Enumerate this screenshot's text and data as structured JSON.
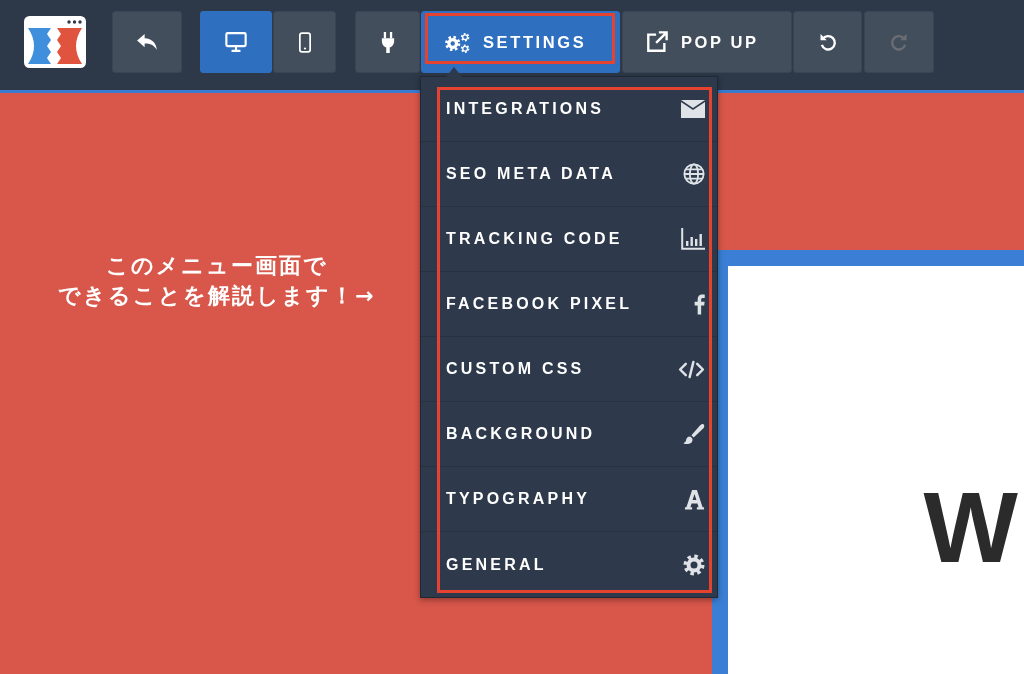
{
  "toolbar": {
    "back_button": {
      "disabled": false
    },
    "view_modes": [
      {
        "selected": true
      },
      {
        "selected": false
      }
    ],
    "panels": [
      {
        "selected": false,
        "outlined": false
      },
      {
        "label": "SETTINGS",
        "selected": true,
        "outlined": true
      },
      {
        "label": "POP UP",
        "selected": false,
        "outlined": false
      }
    ],
    "history": [
      {
        "disabled": false
      },
      {
        "disabled": true
      }
    ]
  },
  "settings_menu": {
    "outlined": true,
    "items": [
      {
        "label": "INTEGRATIONS"
      },
      {
        "label": "SEO META DATA"
      },
      {
        "label": "TRACKING CODE"
      },
      {
        "label": "FACEBOOK PIXEL"
      },
      {
        "label": "CUSTOM CSS"
      },
      {
        "label": "BACKGROUND"
      },
      {
        "label": "TYPOGRAPHY"
      },
      {
        "label": "GENERAL"
      }
    ]
  },
  "caption": [
    "このメニュー画面で",
    "できることを解説します！→"
  ],
  "preview": {
    "heading": "W"
  }
}
